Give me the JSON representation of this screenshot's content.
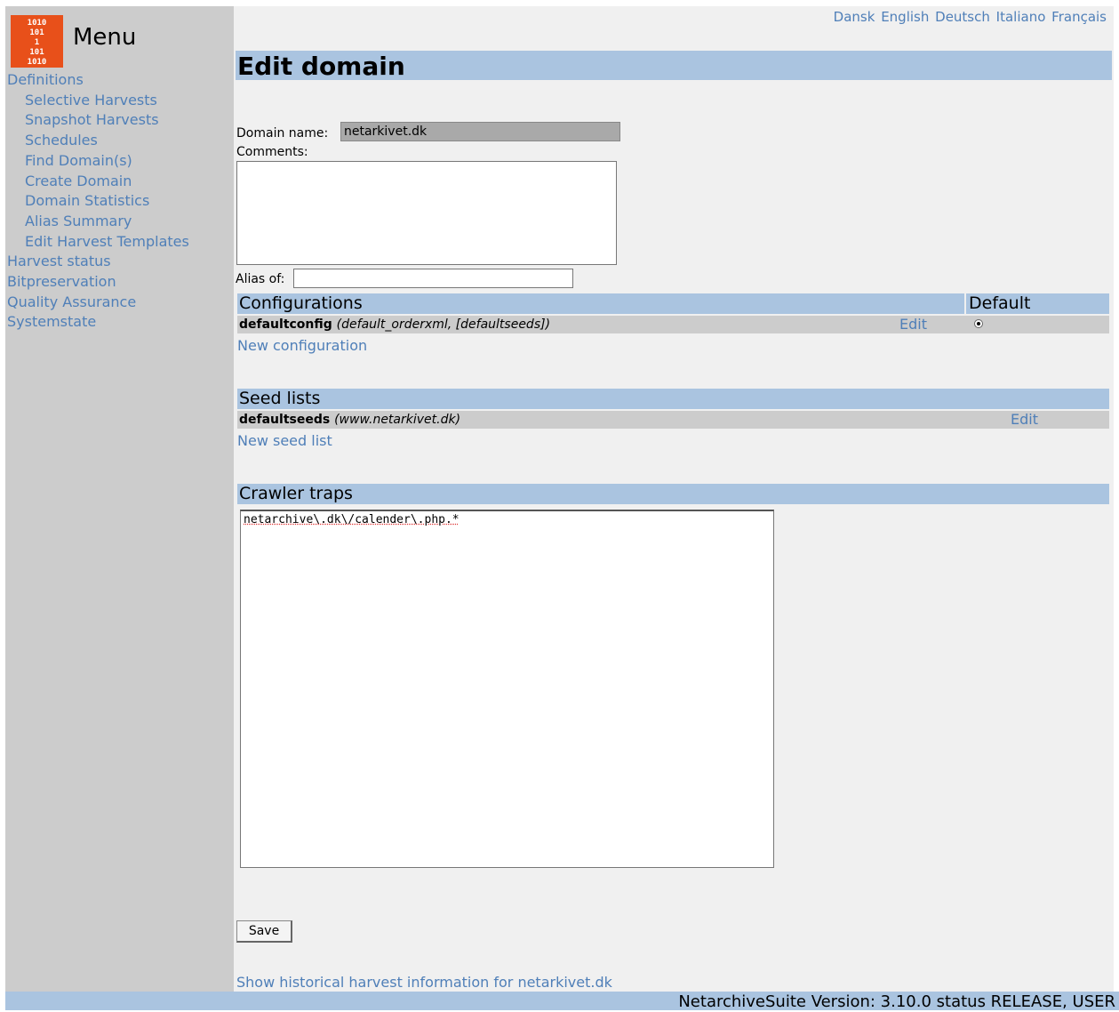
{
  "sidebar": {
    "logo_text": "1010\n101\n1\n101\n1010",
    "title": "Menu",
    "items": [
      {
        "label": "Definitions",
        "level": 1
      },
      {
        "label": "Selective Harvests",
        "level": 2
      },
      {
        "label": "Snapshot Harvests",
        "level": 2
      },
      {
        "label": "Schedules",
        "level": 2
      },
      {
        "label": "Find Domain(s)",
        "level": 2
      },
      {
        "label": "Create Domain",
        "level": 2
      },
      {
        "label": "Domain Statistics",
        "level": 2
      },
      {
        "label": "Alias Summary",
        "level": 2
      },
      {
        "label": "Edit Harvest Templates",
        "level": 2
      },
      {
        "label": "Harvest status",
        "level": 1
      },
      {
        "label": "Bitpreservation",
        "level": 1
      },
      {
        "label": "Quality Assurance",
        "level": 1
      },
      {
        "label": "Systemstate",
        "level": 1
      }
    ]
  },
  "languages": [
    "Dansk",
    "English",
    "Deutsch",
    "Italiano",
    "Français"
  ],
  "page": {
    "title": "Edit domain",
    "domain_name_label": "Domain name:",
    "domain_name_value": "netarkivet.dk",
    "comments_label": "Comments:",
    "comments_value": "",
    "alias_label": "Alias of:",
    "alias_value": ""
  },
  "configurations": {
    "header": "Configurations",
    "default_header": "Default",
    "rows": [
      {
        "name": "defaultconfig",
        "desc": "(default_orderxml, [defaultseeds])",
        "edit": "Edit",
        "is_default": true
      }
    ],
    "new_link": "New configuration"
  },
  "seedlists": {
    "header": "Seed lists",
    "rows": [
      {
        "name": "defaultseeds",
        "desc": "(www.netarkivet.dk)",
        "edit": "Edit"
      }
    ],
    "new_link": "New seed list"
  },
  "crawlertraps": {
    "header": "Crawler traps",
    "value": "netarchive\\.dk\\/calender\\.php.*"
  },
  "save_label": "Save",
  "history_link": "Show historical harvest information for netarkivet.dk",
  "footer": "NetarchiveSuite Version: 3.10.0 status RELEASE, USER"
}
